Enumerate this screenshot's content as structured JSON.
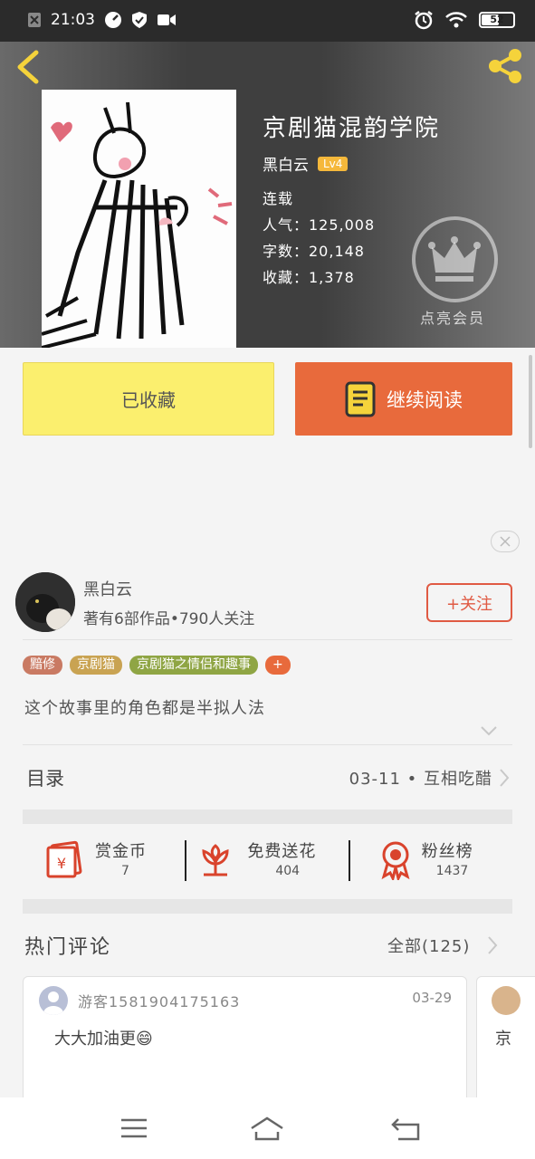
{
  "status_bar": {
    "time": "21:03",
    "battery": "52"
  },
  "book": {
    "title": "京剧猫混韵学院",
    "author": "黑白云",
    "level": "Lv4",
    "status": "连载",
    "popularity": "人气：125,008",
    "words": "字数：20,148",
    "favorites": "收藏：1,378",
    "vip_label": "点亮会员"
  },
  "actions": {
    "collected": "已收藏",
    "continue": "继续阅读"
  },
  "author": {
    "name": "黑白云",
    "works": "著有6部作品•790人关注",
    "follow": "+关注"
  },
  "tags": [
    {
      "label": "黯修",
      "color": "#c97a63"
    },
    {
      "label": "京剧猫",
      "color": "#c9a352"
    },
    {
      "label": "京剧猫之情侣和趣事",
      "color": "#8fa544"
    },
    {
      "label": "+",
      "color": "#e86a3c"
    }
  ],
  "synopsis": "这个故事里的角色都是半拟人法",
  "toc": {
    "label": "目录",
    "latest": "03-11 • 互相吃醋"
  },
  "rewards": [
    {
      "label": "赏金币",
      "count": "7",
      "icon": "red-envelope-icon"
    },
    {
      "label": "免费送花",
      "count": "404",
      "icon": "flower-icon"
    },
    {
      "label": "粉丝榜",
      "count": "1437",
      "icon": "medal-icon"
    }
  ],
  "comments": {
    "title": "热门评论",
    "all": "全部(125)",
    "items": [
      {
        "user": "游客1581904175163",
        "date": "03-29",
        "text": "大大加油更😄"
      },
      {
        "text": "京"
      }
    ]
  },
  "colors": {
    "accent": "#e86a3c",
    "collected_bg": "#fbef6e",
    "follow": "#e05a43"
  }
}
